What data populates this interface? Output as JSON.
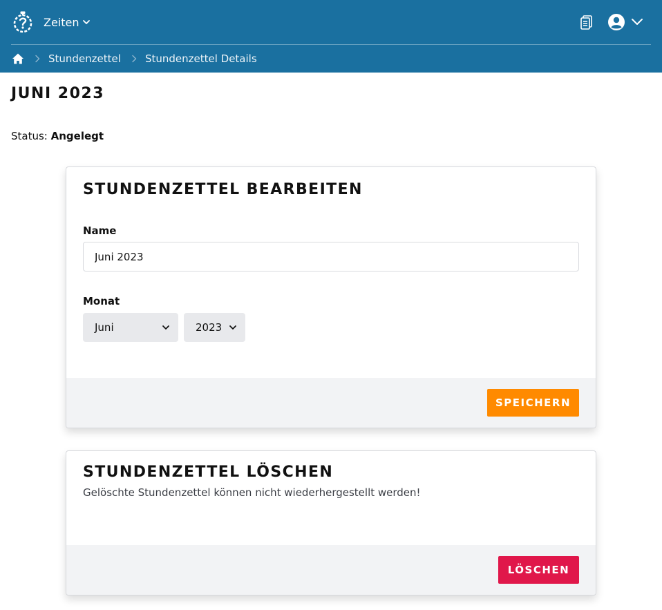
{
  "header": {
    "menu_label": "Zeiten",
    "icons": {
      "logo": "stopwatch-logo-icon",
      "documents": "documents-icon",
      "account": "user-circle-icon"
    }
  },
  "breadcrumb": {
    "items": [
      "Stundenzettel",
      "Stundenzettel Details"
    ]
  },
  "page": {
    "title": "JUNI 2023",
    "status_label": "Status:",
    "status_value": "Angelegt"
  },
  "edit_card": {
    "title": "STUNDENZETTEL BEARBEITEN",
    "name_label": "Name",
    "name_value": "Juni 2023",
    "month_label": "Monat",
    "month_selected": "Juni",
    "year_selected": "2023",
    "save_label": "SPEICHERN"
  },
  "delete_card": {
    "title": "STUNDENZETTEL LÖSCHEN",
    "description": "Gelöschte Stundenzettel können nicht wiederhergestellt werden!",
    "delete_label": "LÖSCHEN"
  },
  "colors": {
    "header_bg": "#1a70a0",
    "save_button": "#ff8a00",
    "delete_button": "#e0174a",
    "footer_bg": "#f2f3f5"
  }
}
